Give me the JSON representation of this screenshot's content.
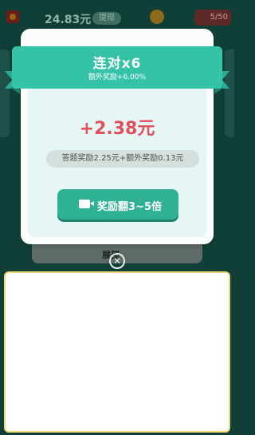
{
  "topbar": {
    "balance": "24.83元",
    "withdraw_label": "提现",
    "progress": "5/50"
  },
  "background": {
    "hint_text": "展部"
  },
  "modal": {
    "title": "连对x6",
    "subtitle": "额外奖励+6.00%",
    "amount": "+2.38元",
    "detail": "答题奖励2.25元+额外奖励0.13元",
    "action_label": "奖励翻3~5倍",
    "close_symbol": "✕"
  },
  "colors": {
    "ribbon": "#35c3a8",
    "amount": "#e0505b",
    "button": "#2fb196",
    "ad_border": "#f0d877"
  },
  "icons": [
    "coin-icon",
    "gift-icon",
    "video-icon",
    "close-icon"
  ]
}
